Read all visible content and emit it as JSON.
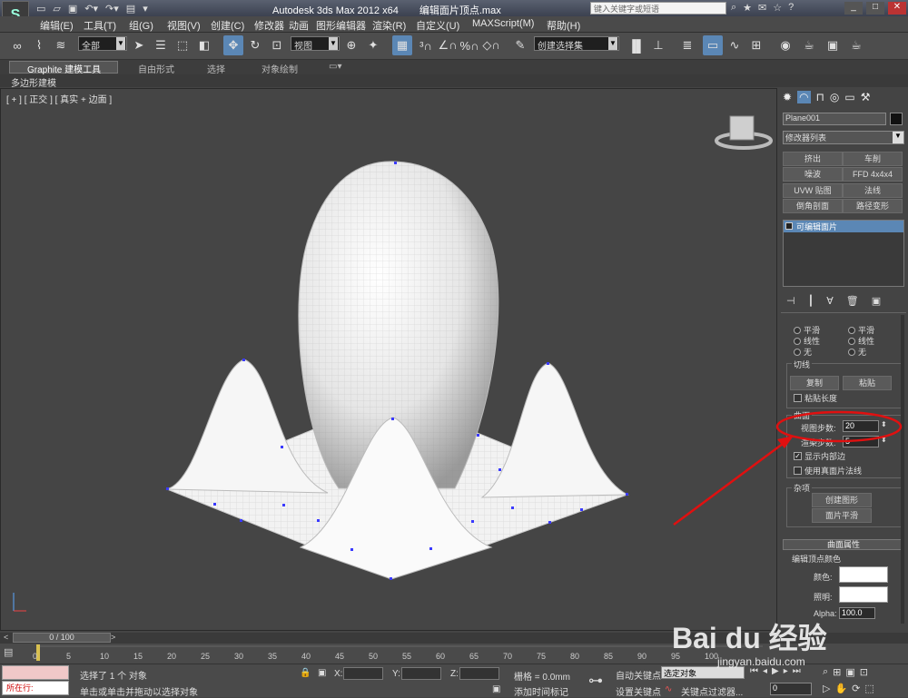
{
  "app": {
    "title": "Autodesk 3ds Max  2012 x64",
    "file": "编辑面片顶点.max",
    "search_placeholder": "键入关键字或短语"
  },
  "menu": [
    "编辑(E)",
    "工具(T)",
    "组(G)",
    "视图(V)",
    "创建(C)",
    "修改器",
    "动画",
    "图形编辑器",
    "渲染(R)",
    "自定义(U)",
    "MAXScript(M)",
    "帮助(H)"
  ],
  "toolbar": {
    "selection_filter": "全部",
    "ref_coord": "视图",
    "named_selection": "创建选择集"
  },
  "ribbon": {
    "tabs": [
      "Graphite 建模工具",
      "自由形式",
      "选择",
      "对象绘制"
    ],
    "sub_label": "多边形建模"
  },
  "viewport": {
    "label": "[ + ] [ 正交 ] [ 真实 + 边面 ]"
  },
  "command_panel": {
    "object_name": "Plane001",
    "modifier_list": "修改器列表",
    "modifier_buttons": [
      "挤出",
      "车削",
      "噪波",
      "FFD 4x4x4",
      "UVW 贴图",
      "法线",
      "倒角剖面",
      "路径变形"
    ],
    "stack_item": "可编辑面片",
    "radio_col1": [
      "平滑",
      "线性",
      "无"
    ],
    "radio_col2": [
      "平滑",
      "线性",
      "无"
    ],
    "tangent_group": "切线",
    "copy_btn": "复制",
    "paste_btn": "粘贴",
    "paste_length": "粘贴长度",
    "surface_group": "曲面",
    "view_steps_label": "视图步数:",
    "view_steps_value": "20",
    "render_steps_label": "渲染步数:",
    "render_steps_value": "5",
    "show_interior": "显示内部边",
    "use_true_normals": "使用真面片法线",
    "misc_group": "杂项",
    "create_shape_btn": "创建图形",
    "patch_smooth_btn": "面片平滑",
    "surface_props": "曲面属性",
    "edit_vertex_color": "编辑顶点颜色",
    "color_label": "颜色:",
    "illum_label": "照明:",
    "alpha_label": "Alpha:",
    "alpha_value": "100.0"
  },
  "timeline": {
    "frame": "0 / 100",
    "ticks": [
      "0",
      "5",
      "10",
      "15",
      "20",
      "25",
      "30",
      "35",
      "40",
      "45",
      "50",
      "55",
      "60",
      "65",
      "70",
      "75",
      "80",
      "85",
      "90",
      "95",
      "100"
    ]
  },
  "status": {
    "selected": "选择了 1 个 对象",
    "hint": "单击或单击并拖动以选择对象",
    "in_progress": "所在行:",
    "x_label": "X:",
    "y_label": "Y:",
    "z_label": "Z:",
    "grid": "栅格 = 0.0mm",
    "auto_key": "自动关键点",
    "set_key": "设置关键点",
    "selected_obj": "选定对象",
    "key_filter": "关键点过滤器...",
    "add_time_tag": "添加时间标记",
    "frame_value": "0"
  },
  "watermark": "Bai du 经验",
  "watermark_url": "jingyan.baidu.com"
}
